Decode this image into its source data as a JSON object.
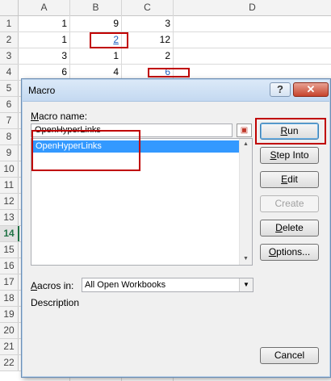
{
  "sheet": {
    "columns": [
      "A",
      "B",
      "C",
      "D"
    ],
    "rows": [
      "1",
      "2",
      "3",
      "4",
      "5",
      "6",
      "7",
      "8",
      "9",
      "10",
      "11",
      "12",
      "13",
      "14",
      "15",
      "16",
      "17",
      "18",
      "19",
      "20",
      "21",
      "22"
    ],
    "active_row": "14",
    "cells": {
      "A1": "1",
      "B1": "9",
      "C1": "3",
      "A2": "1",
      "B2": "2",
      "C2": "12",
      "A3": "3",
      "B3": "1",
      "C3": "2",
      "A4": "6",
      "B4": "4",
      "C4": "6"
    },
    "highlight_color": "#c00000",
    "hyperlink_color": "#1f5fbf"
  },
  "dialog": {
    "title": "Macro",
    "help_label": "?",
    "close_label": "✕",
    "macro_name_label": "Macro name:",
    "macro_name_value": "OpenHyperLinks",
    "macro_list": [
      "OpenHyperLinks"
    ],
    "macros_in_label": "Macros in:",
    "macros_in_value": "All Open Workbooks",
    "description_label": "Description",
    "buttons": {
      "run": "Run",
      "step_into": "Step Into",
      "edit": "Edit",
      "create": "Create",
      "delete": "Delete",
      "options": "Options...",
      "cancel": "Cancel"
    }
  },
  "icons": {
    "name_picker": "collapse-dialog-icon",
    "scroll_up": "scroll-up-arrow-icon",
    "scroll_down": "scroll-down-arrow-icon",
    "dropdown": "chevron-down-icon"
  },
  "accent": "#217346",
  "selection_color": "#3399ff"
}
